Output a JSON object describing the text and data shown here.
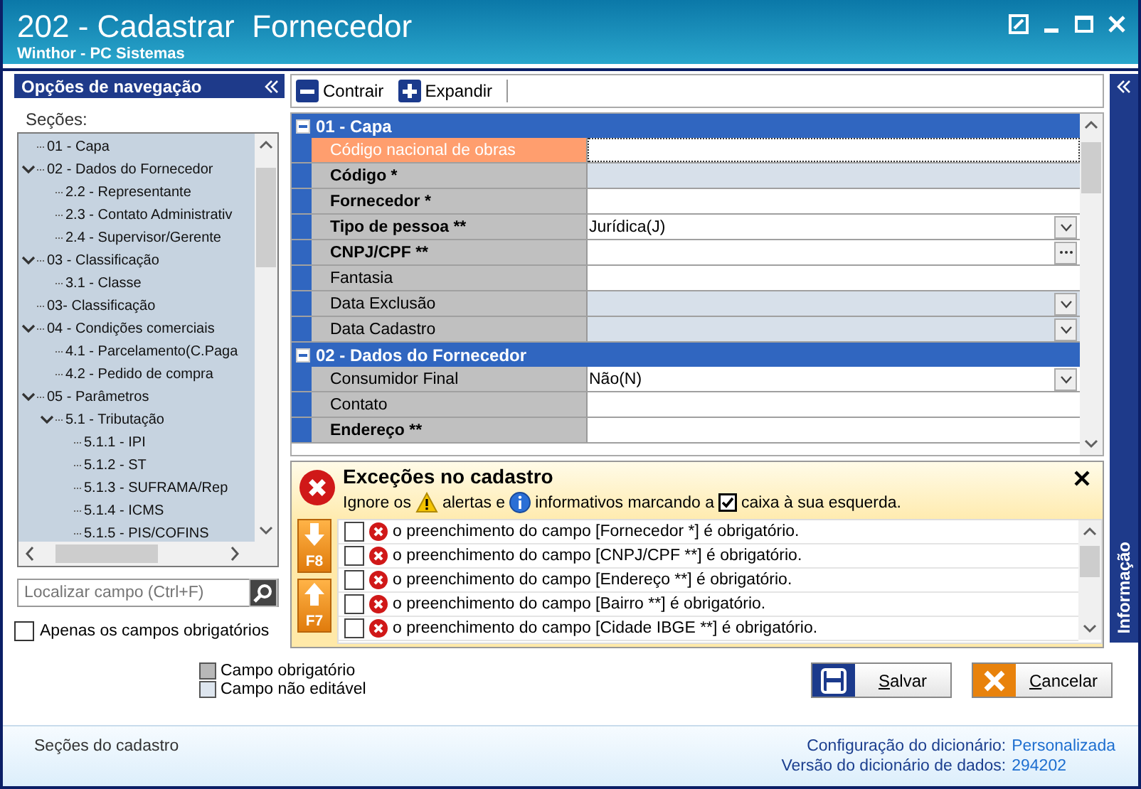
{
  "window": {
    "title": "202 - Cadastrar  Fornecedor",
    "subtitle": "Winthor - PC Sistemas"
  },
  "nav": {
    "title": "Opções de navegação",
    "group_label": "Seções:",
    "tree": [
      {
        "label": "01 - Capa"
      },
      {
        "label": "02 - Dados do Fornecedor",
        "expanded": true,
        "children": [
          {
            "label": "2.2 - Representante"
          },
          {
            "label": "2.3 - Contato Administrativ"
          },
          {
            "label": "2.4 - Supervisor/Gerente"
          }
        ]
      },
      {
        "label": "03 - Classificação",
        "expanded": true,
        "children": [
          {
            "label": "3.1 - Classe"
          }
        ]
      },
      {
        "label": "03- Classificação"
      },
      {
        "label": "04 - Condições comerciais",
        "expanded": true,
        "children": [
          {
            "label": "4.1 - Parcelamento(C.Paga"
          },
          {
            "label": "4.2 - Pedido de compra"
          }
        ]
      },
      {
        "label": "05 - Parâmetros",
        "expanded": true,
        "children": [
          {
            "label": "5.1 - Tributação",
            "expanded": true,
            "children": [
              {
                "label": "5.1.1 - IPI"
              },
              {
                "label": "5.1.2 - ST"
              },
              {
                "label": "5.1.3 - SUFRAMA/Rep"
              },
              {
                "label": "5.1.4 - ICMS"
              },
              {
                "label": "5.1.5 - PIS/COFINS"
              }
            ]
          }
        ]
      }
    ],
    "search": {
      "placeholder": "Localizar campo (Ctrl+F)"
    },
    "only_required": {
      "label": "Apenas os campos obrigatórios",
      "checked": false
    }
  },
  "toolbar": [
    {
      "kind": "collapse",
      "label": "Contrair"
    },
    {
      "kind": "expand",
      "label": "Expandir"
    }
  ],
  "grid": {
    "sections": [
      {
        "title": "01 - Capa",
        "expanded": true,
        "rows": [
          {
            "label": "Código nacional de obras",
            "required": false,
            "kind": "text",
            "readonly": false,
            "selected": true
          },
          {
            "label": "Código *",
            "required": true,
            "kind": "text",
            "readonly": true,
            "selected": false
          },
          {
            "label": "Fornecedor *",
            "required": true,
            "kind": "text",
            "readonly": false,
            "selected": false
          },
          {
            "label": "Tipo de pessoa **",
            "required": true,
            "value": "Jurídica(J)",
            "kind": "dropdown",
            "readonly": false,
            "selected": false
          },
          {
            "label": "CNPJ/CPF **",
            "required": true,
            "kind": "ellipsis",
            "readonly": false,
            "selected": false
          },
          {
            "label": "Fantasia",
            "required": false,
            "kind": "text",
            "readonly": false,
            "selected": false
          },
          {
            "label": "Data Exclusão",
            "required": false,
            "kind": "dropdown",
            "readonly": true,
            "selected": false
          },
          {
            "label": "Data Cadastro",
            "required": false,
            "kind": "dropdown",
            "readonly": true,
            "selected": false
          }
        ]
      },
      {
        "title": "02 - Dados do Fornecedor",
        "expanded": true,
        "rows": [
          {
            "label": "Consumidor Final",
            "required": false,
            "value": "Não(N)",
            "kind": "dropdown",
            "readonly": false,
            "selected": false
          },
          {
            "label": "Contato",
            "required": false,
            "kind": "text",
            "readonly": false,
            "selected": false
          },
          {
            "label": "Endereço **",
            "required": true,
            "kind": "text",
            "readonly": false,
            "selected": false
          }
        ]
      }
    ]
  },
  "exceptions": {
    "title": "Exceções no cadastro",
    "hint": [
      "Ignore os",
      "alertas e",
      "informativos marcando a",
      "caixa à sua esquerda."
    ],
    "nav_keys": [
      {
        "kind": "down",
        "label": "F8"
      },
      {
        "kind": "up",
        "label": "F7"
      }
    ],
    "messages": [
      {
        "checked": false,
        "text": "o preenchimento do campo [Fornecedor *] é obrigatório."
      },
      {
        "checked": false,
        "text": "o preenchimento do campo [CNPJ/CPF **] é obrigatório."
      },
      {
        "checked": false,
        "text": "o preenchimento do campo [Endereço **] é obrigatório."
      },
      {
        "checked": false,
        "text": "o preenchimento do campo [Bairro **] é obrigatório."
      },
      {
        "checked": false,
        "text": "o preenchimento do campo [Cidade IBGE **] é obrigatório."
      }
    ]
  },
  "info_panel": {
    "title": "Informação"
  },
  "legend": [
    {
      "kind": "required",
      "label": "Campo obrigatório"
    },
    {
      "kind": "readonly",
      "label": "Campo não editável"
    }
  ],
  "buttons": [
    {
      "kind": "save",
      "label": "Salvar"
    },
    {
      "kind": "cancel",
      "label": "Cancelar"
    }
  ],
  "status_bar": {
    "left": "Seções do cadastro",
    "details": [
      {
        "label": "Configuração do dicionário:",
        "value": "Personalizada"
      },
      {
        "label": "Versão do dicionário de dados:",
        "value": "294202"
      }
    ]
  }
}
